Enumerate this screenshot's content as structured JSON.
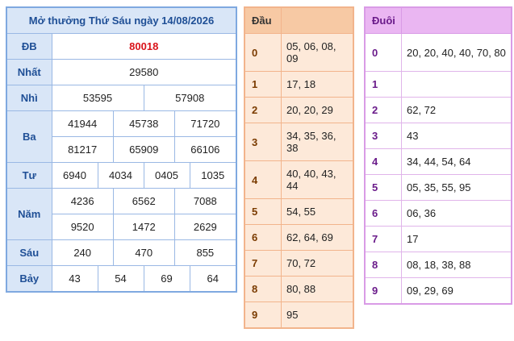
{
  "results": {
    "title": "Mở thưởng Thứ Sáu ngày 14/08/2026",
    "rows": {
      "db": {
        "label": "ĐB",
        "values": [
          "80018"
        ]
      },
      "nhat": {
        "label": "Nhất",
        "values": [
          "29580"
        ]
      },
      "nhi": {
        "label": "Nhì",
        "values": [
          "53595",
          "57908"
        ]
      },
      "ba": {
        "label": "Ba",
        "values": [
          "41944",
          "45738",
          "71720",
          "81217",
          "65909",
          "66106"
        ]
      },
      "tu": {
        "label": "Tư",
        "values": [
          "6940",
          "4034",
          "0405",
          "1035"
        ]
      },
      "nam": {
        "label": "Năm",
        "values": [
          "4236",
          "6562",
          "7088",
          "9520",
          "1472",
          "2629"
        ]
      },
      "sau": {
        "label": "Sáu",
        "values": [
          "240",
          "470",
          "855"
        ]
      },
      "bay": {
        "label": "Bảy",
        "values": [
          "43",
          "54",
          "69",
          "64"
        ]
      }
    }
  },
  "dau": {
    "header": "Đầu",
    "rows": [
      {
        "key": "0",
        "value": "05, 06, 08, 09"
      },
      {
        "key": "1",
        "value": "17, 18"
      },
      {
        "key": "2",
        "value": "20, 20, 29"
      },
      {
        "key": "3",
        "value": "34, 35, 36, 38"
      },
      {
        "key": "4",
        "value": "40, 40, 43, 44"
      },
      {
        "key": "5",
        "value": "54, 55"
      },
      {
        "key": "6",
        "value": "62, 64, 69"
      },
      {
        "key": "7",
        "value": "70, 72"
      },
      {
        "key": "8",
        "value": "80, 88"
      },
      {
        "key": "9",
        "value": "95"
      }
    ]
  },
  "duoi": {
    "header": "Đuôi",
    "rows": [
      {
        "key": "0",
        "value": "20, 20, 40, 40, 70, 80"
      },
      {
        "key": "1",
        "value": ""
      },
      {
        "key": "2",
        "value": "62, 72"
      },
      {
        "key": "3",
        "value": "43"
      },
      {
        "key": "4",
        "value": "34, 44, 54, 64"
      },
      {
        "key": "5",
        "value": "05, 35, 55, 95"
      },
      {
        "key": "6",
        "value": "06, 36"
      },
      {
        "key": "7",
        "value": "17"
      },
      {
        "key": "8",
        "value": "08, 18, 38, 88"
      },
      {
        "key": "9",
        "value": "09, 29, 69"
      }
    ]
  },
  "colors": {
    "label_bg": "#d9e6f7",
    "label_text": "#1f4f96",
    "special_prize": "#d9131a",
    "dau_bg": "#fde9d9",
    "dau_header": "#f7c9a4",
    "duoi_header": "#eab6f2"
  }
}
